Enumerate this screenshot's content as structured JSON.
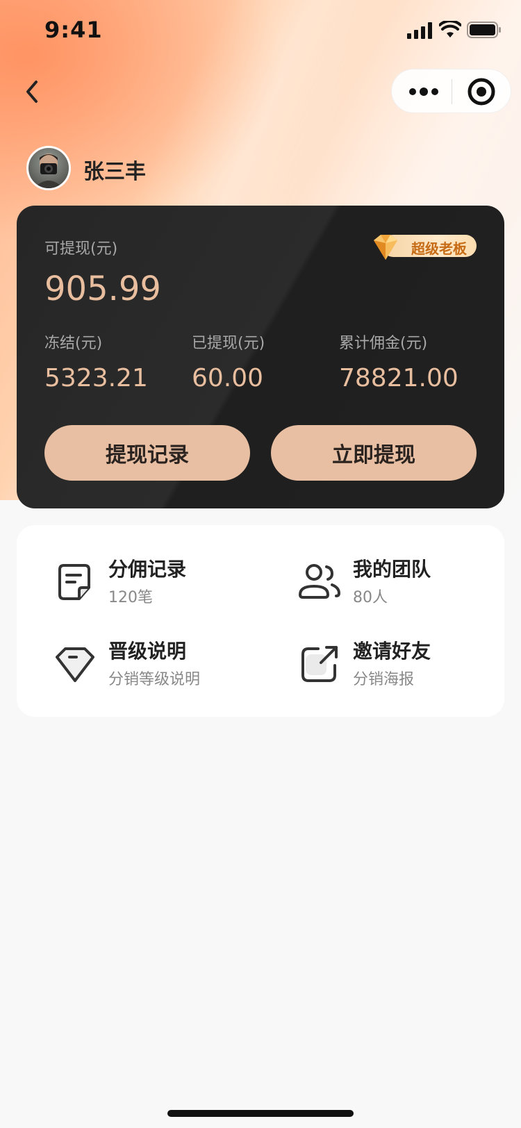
{
  "status_bar": {
    "time": "9:41"
  },
  "user": {
    "name": "张三丰"
  },
  "wallet": {
    "available_label": "可提现(元)",
    "available_value": "905.99",
    "vip_badge": "超级老板",
    "stats": [
      {
        "label": "冻结(元)",
        "value": "5323.21"
      },
      {
        "label": "已提现(元)",
        "value": "60.00"
      },
      {
        "label": "累计佣金(元)",
        "value": "78821.00"
      }
    ],
    "buttons": {
      "records": "提现记录",
      "withdraw": "立即提现"
    }
  },
  "menu": [
    {
      "title": "分佣记录",
      "sub": "120笔",
      "icon": "commission-record-icon"
    },
    {
      "title": "我的团队",
      "sub": "80人",
      "icon": "team-icon"
    },
    {
      "title": "晋级说明",
      "sub": "分销等级说明",
      "icon": "diamond-icon"
    },
    {
      "title": "邀请好友",
      "sub": "分销海报",
      "icon": "share-icon"
    }
  ],
  "colors": {
    "accent": "#e8bfa2",
    "amount": "#e9be9f",
    "card_bg": "#262626",
    "badge_text": "#c66b16"
  }
}
